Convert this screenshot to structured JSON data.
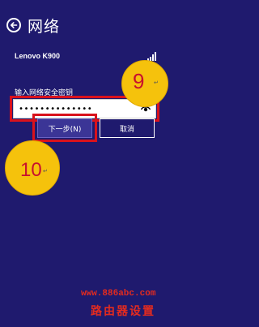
{
  "header": {
    "title": "网络",
    "back_icon": "back-arrow-icon"
  },
  "network": {
    "name": "Lenovo K900",
    "signal_icon": "wifi-signal-icon"
  },
  "password": {
    "label": "输入网络安全密钥",
    "masked_value": "••••••••••••••",
    "reveal_icon": "eye-icon"
  },
  "buttons": {
    "next_label": "下一步(N)",
    "cancel_label": "取消"
  },
  "annotations": {
    "step9": {
      "number": "9",
      "mark": "↵"
    },
    "step10": {
      "number": "10",
      "mark": "↵"
    }
  },
  "watermark": {
    "url": "www.886abc.com",
    "text": "路由器设置"
  },
  "colors": {
    "background": "#1f1a6e",
    "highlight": "#d9121c",
    "badge": "#f5c20c",
    "watermark": "#e32b1f"
  }
}
